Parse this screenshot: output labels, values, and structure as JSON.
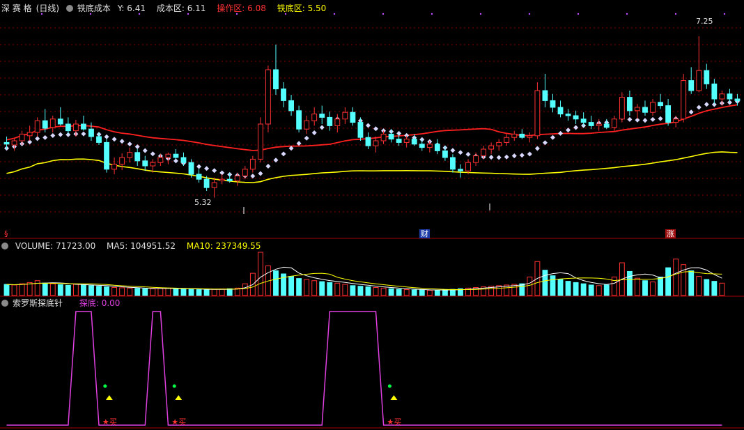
{
  "stock": {
    "name": "深 赛 格",
    "period": "(日线)"
  },
  "main_indicator": {
    "name": "铁底成本",
    "y_label": "Y:",
    "y_value": "6.41",
    "cost_label": "成本区:",
    "cost_value": "6.11",
    "operate_label": "操作区:",
    "operate_value": "6.08",
    "bottom_label": "铁底区:",
    "bottom_value": "5.50"
  },
  "price_marks": {
    "high": "7.25",
    "low": "5.32"
  },
  "event_tags": {
    "left": "§",
    "mid": "财",
    "right": "涨"
  },
  "volume_panel": {
    "label": "VOLUME:",
    "value": "71723.00",
    "ma5_label": "MA5:",
    "ma5_value": "104951.52",
    "ma10_label": "MA10:",
    "ma10_value": "237349.55"
  },
  "signal_panel": {
    "name": "索罗斯探底针",
    "indicator_label": "探底:",
    "indicator_value": "0.00",
    "buy_label": "买"
  },
  "colors": {
    "up": "#ff3232",
    "down": "#54ffff",
    "ma_red": "#ff2020",
    "ma_yellow": "#ffff00",
    "diamond": "#d8d8ff",
    "signal": "#e040e0",
    "grid": "#8b0000"
  },
  "chart_data": {
    "type": "candlestick",
    "price_axis": [
      5.0,
      7.5
    ],
    "candles": [
      {
        "o": 5.98,
        "h": 6.05,
        "l": 5.9,
        "c": 5.96
      },
      {
        "o": 5.95,
        "h": 6.02,
        "l": 5.88,
        "c": 6.0
      },
      {
        "o": 6.0,
        "h": 6.12,
        "l": 5.95,
        "c": 6.08
      },
      {
        "o": 6.06,
        "h": 6.18,
        "l": 6.0,
        "c": 6.1
      },
      {
        "o": 6.1,
        "h": 6.28,
        "l": 6.05,
        "c": 6.24
      },
      {
        "o": 6.24,
        "h": 6.38,
        "l": 6.1,
        "c": 6.15
      },
      {
        "o": 6.16,
        "h": 6.3,
        "l": 6.1,
        "c": 6.26
      },
      {
        "o": 6.26,
        "h": 6.4,
        "l": 6.18,
        "c": 6.2
      },
      {
        "o": 6.2,
        "h": 6.28,
        "l": 6.08,
        "c": 6.12
      },
      {
        "o": 6.12,
        "h": 6.25,
        "l": 6.05,
        "c": 6.2
      },
      {
        "o": 6.2,
        "h": 6.3,
        "l": 6.12,
        "c": 6.14
      },
      {
        "o": 6.14,
        "h": 6.22,
        "l": 6.0,
        "c": 6.05
      },
      {
        "o": 6.05,
        "h": 6.1,
        "l": 5.95,
        "c": 5.98
      },
      {
        "o": 5.98,
        "h": 6.02,
        "l": 5.62,
        "c": 5.66
      },
      {
        "o": 5.66,
        "h": 5.8,
        "l": 5.6,
        "c": 5.72
      },
      {
        "o": 5.72,
        "h": 5.85,
        "l": 5.65,
        "c": 5.8
      },
      {
        "o": 5.8,
        "h": 5.92,
        "l": 5.74,
        "c": 5.86
      },
      {
        "o": 5.86,
        "h": 5.9,
        "l": 5.7,
        "c": 5.76
      },
      {
        "o": 5.76,
        "h": 5.82,
        "l": 5.64,
        "c": 5.7
      },
      {
        "o": 5.7,
        "h": 5.78,
        "l": 5.62,
        "c": 5.74
      },
      {
        "o": 5.74,
        "h": 5.84,
        "l": 5.7,
        "c": 5.8
      },
      {
        "o": 5.8,
        "h": 5.86,
        "l": 5.72,
        "c": 5.84
      },
      {
        "o": 5.84,
        "h": 5.9,
        "l": 5.78,
        "c": 5.8
      },
      {
        "o": 5.8,
        "h": 5.86,
        "l": 5.7,
        "c": 5.74
      },
      {
        "o": 5.74,
        "h": 5.78,
        "l": 5.56,
        "c": 5.6
      },
      {
        "o": 5.6,
        "h": 5.66,
        "l": 5.5,
        "c": 5.54
      },
      {
        "o": 5.54,
        "h": 5.58,
        "l": 5.4,
        "c": 5.44
      },
      {
        "o": 5.44,
        "h": 5.56,
        "l": 5.32,
        "c": 5.5
      },
      {
        "o": 5.52,
        "h": 5.6,
        "l": 5.48,
        "c": 5.54
      },
      {
        "o": 5.54,
        "h": 5.62,
        "l": 5.5,
        "c": 5.52
      },
      {
        "o": 5.52,
        "h": 5.62,
        "l": 5.46,
        "c": 5.58
      },
      {
        "o": 5.58,
        "h": 5.7,
        "l": 5.54,
        "c": 5.66
      },
      {
        "o": 5.66,
        "h": 5.82,
        "l": 5.62,
        "c": 5.78
      },
      {
        "o": 5.78,
        "h": 6.28,
        "l": 5.74,
        "c": 6.2
      },
      {
        "o": 6.2,
        "h": 6.9,
        "l": 6.1,
        "c": 6.85
      },
      {
        "o": 6.85,
        "h": 7.15,
        "l": 6.55,
        "c": 6.62
      },
      {
        "o": 6.62,
        "h": 6.7,
        "l": 6.4,
        "c": 6.48
      },
      {
        "o": 6.48,
        "h": 6.55,
        "l": 6.3,
        "c": 6.36
      },
      {
        "o": 6.36,
        "h": 6.42,
        "l": 6.1,
        "c": 6.14
      },
      {
        "o": 6.14,
        "h": 6.3,
        "l": 6.08,
        "c": 6.24
      },
      {
        "o": 6.24,
        "h": 6.4,
        "l": 6.18,
        "c": 6.32
      },
      {
        "o": 6.32,
        "h": 6.42,
        "l": 6.2,
        "c": 6.28
      },
      {
        "o": 6.28,
        "h": 6.35,
        "l": 6.12,
        "c": 6.18
      },
      {
        "o": 6.18,
        "h": 6.32,
        "l": 6.1,
        "c": 6.26
      },
      {
        "o": 6.26,
        "h": 6.4,
        "l": 6.2,
        "c": 6.34
      },
      {
        "o": 6.34,
        "h": 6.4,
        "l": 6.18,
        "c": 6.22
      },
      {
        "o": 6.22,
        "h": 6.28,
        "l": 6.0,
        "c": 6.04
      },
      {
        "o": 6.04,
        "h": 6.1,
        "l": 5.9,
        "c": 5.94
      },
      {
        "o": 5.94,
        "h": 6.05,
        "l": 5.86,
        "c": 6.0
      },
      {
        "o": 6.0,
        "h": 6.12,
        "l": 5.96,
        "c": 6.08
      },
      {
        "o": 6.08,
        "h": 6.14,
        "l": 5.98,
        "c": 6.02
      },
      {
        "o": 6.02,
        "h": 6.08,
        "l": 5.94,
        "c": 5.98
      },
      {
        "o": 5.98,
        "h": 6.06,
        "l": 5.92,
        "c": 6.02
      },
      {
        "o": 6.02,
        "h": 6.08,
        "l": 5.94,
        "c": 5.96
      },
      {
        "o": 5.96,
        "h": 6.02,
        "l": 5.88,
        "c": 5.92
      },
      {
        "o": 5.92,
        "h": 6.0,
        "l": 5.86,
        "c": 5.96
      },
      {
        "o": 5.96,
        "h": 6.02,
        "l": 5.84,
        "c": 5.88
      },
      {
        "o": 5.88,
        "h": 5.94,
        "l": 5.76,
        "c": 5.8
      },
      {
        "o": 5.8,
        "h": 5.84,
        "l": 5.62,
        "c": 5.66
      },
      {
        "o": 5.66,
        "h": 5.72,
        "l": 5.56,
        "c": 5.64
      },
      {
        "o": 5.64,
        "h": 5.78,
        "l": 5.6,
        "c": 5.74
      },
      {
        "o": 5.74,
        "h": 5.86,
        "l": 5.7,
        "c": 5.82
      },
      {
        "o": 5.82,
        "h": 5.94,
        "l": 5.78,
        "c": 5.9
      },
      {
        "o": 5.9,
        "h": 5.98,
        "l": 5.84,
        "c": 5.94
      },
      {
        "o": 5.94,
        "h": 6.02,
        "l": 5.88,
        "c": 5.98
      },
      {
        "o": 5.98,
        "h": 6.08,
        "l": 5.94,
        "c": 6.04
      },
      {
        "o": 6.04,
        "h": 6.12,
        "l": 6.0,
        "c": 6.08
      },
      {
        "o": 6.08,
        "h": 6.14,
        "l": 6.02,
        "c": 6.04
      },
      {
        "o": 6.04,
        "h": 6.1,
        "l": 5.98,
        "c": 6.06
      },
      {
        "o": 6.06,
        "h": 6.7,
        "l": 6.02,
        "c": 6.6
      },
      {
        "o": 6.6,
        "h": 6.8,
        "l": 6.4,
        "c": 6.48
      },
      {
        "o": 6.48,
        "h": 6.56,
        "l": 6.34,
        "c": 6.4
      },
      {
        "o": 6.4,
        "h": 6.48,
        "l": 6.28,
        "c": 6.32
      },
      {
        "o": 6.32,
        "h": 6.38,
        "l": 6.24,
        "c": 6.3
      },
      {
        "o": 6.3,
        "h": 6.36,
        "l": 6.2,
        "c": 6.26
      },
      {
        "o": 6.26,
        "h": 6.34,
        "l": 6.18,
        "c": 6.22
      },
      {
        "o": 6.22,
        "h": 6.3,
        "l": 6.14,
        "c": 6.18
      },
      {
        "o": 6.18,
        "h": 6.26,
        "l": 6.12,
        "c": 6.2
      },
      {
        "o": 6.2,
        "h": 6.26,
        "l": 6.14,
        "c": 6.16
      },
      {
        "o": 6.16,
        "h": 6.3,
        "l": 6.12,
        "c": 6.26
      },
      {
        "o": 6.26,
        "h": 6.58,
        "l": 6.22,
        "c": 6.52
      },
      {
        "o": 6.52,
        "h": 6.6,
        "l": 6.3,
        "c": 6.36
      },
      {
        "o": 6.36,
        "h": 6.44,
        "l": 6.26,
        "c": 6.4
      },
      {
        "o": 6.4,
        "h": 6.48,
        "l": 6.3,
        "c": 6.34
      },
      {
        "o": 6.34,
        "h": 6.5,
        "l": 6.3,
        "c": 6.46
      },
      {
        "o": 6.46,
        "h": 6.56,
        "l": 6.38,
        "c": 6.42
      },
      {
        "o": 6.42,
        "h": 6.5,
        "l": 6.18,
        "c": 6.22
      },
      {
        "o": 6.22,
        "h": 6.3,
        "l": 6.16,
        "c": 6.26
      },
      {
        "o": 6.26,
        "h": 6.8,
        "l": 6.22,
        "c": 6.72
      },
      {
        "o": 6.72,
        "h": 6.88,
        "l": 6.56,
        "c": 6.6
      },
      {
        "o": 6.6,
        "h": 7.25,
        "l": 6.58,
        "c": 6.84
      },
      {
        "o": 6.84,
        "h": 6.92,
        "l": 6.62,
        "c": 6.68
      },
      {
        "o": 6.68,
        "h": 6.74,
        "l": 6.44,
        "c": 6.5
      },
      {
        "o": 6.5,
        "h": 6.6,
        "l": 6.42,
        "c": 6.56
      },
      {
        "o": 6.56,
        "h": 6.62,
        "l": 6.46,
        "c": 6.5
      },
      {
        "o": 6.5,
        "h": 6.56,
        "l": 6.42,
        "c": 6.48
      }
    ],
    "volume": [
      36,
      34,
      38,
      42,
      48,
      40,
      38,
      35,
      33,
      36,
      34,
      32,
      30,
      28,
      26,
      25,
      24,
      23,
      22,
      22,
      23,
      24,
      22,
      21,
      20,
      19,
      18,
      20,
      21,
      22,
      24,
      38,
      72,
      140,
      96,
      80,
      70,
      62,
      55,
      52,
      48,
      45,
      42,
      40,
      36,
      32,
      30,
      28,
      26,
      24,
      22,
      20,
      19,
      18,
      18,
      17,
      17,
      18,
      20,
      22,
      24,
      26,
      28,
      30,
      32,
      34,
      36,
      38,
      60,
      110,
      82,
      64,
      52,
      46,
      42,
      38,
      34,
      32,
      34,
      60,
      106,
      78,
      56,
      48,
      44,
      60,
      90,
      118,
      100,
      80,
      62,
      52,
      46,
      40
    ],
    "signal": [
      0,
      0,
      0,
      0,
      0,
      0,
      0,
      0,
      0,
      1,
      1,
      1,
      0,
      0,
      0,
      0,
      0,
      0,
      0,
      1,
      1,
      0,
      0,
      0,
      0,
      0,
      0,
      0,
      0,
      0,
      0,
      0,
      0,
      0,
      0,
      0,
      0,
      0,
      0,
      0,
      0,
      0,
      1,
      1,
      1,
      1,
      1,
      1,
      1,
      0,
      0,
      0,
      0,
      0,
      0,
      0,
      0,
      0,
      0,
      0,
      0,
      0,
      0,
      0,
      0,
      0,
      0,
      0,
      0,
      0,
      0,
      0,
      0,
      0,
      0,
      0,
      0,
      0,
      0,
      0,
      0,
      0,
      0,
      0,
      0,
      0,
      0,
      0,
      0,
      0,
      0,
      0,
      0,
      0
    ]
  }
}
